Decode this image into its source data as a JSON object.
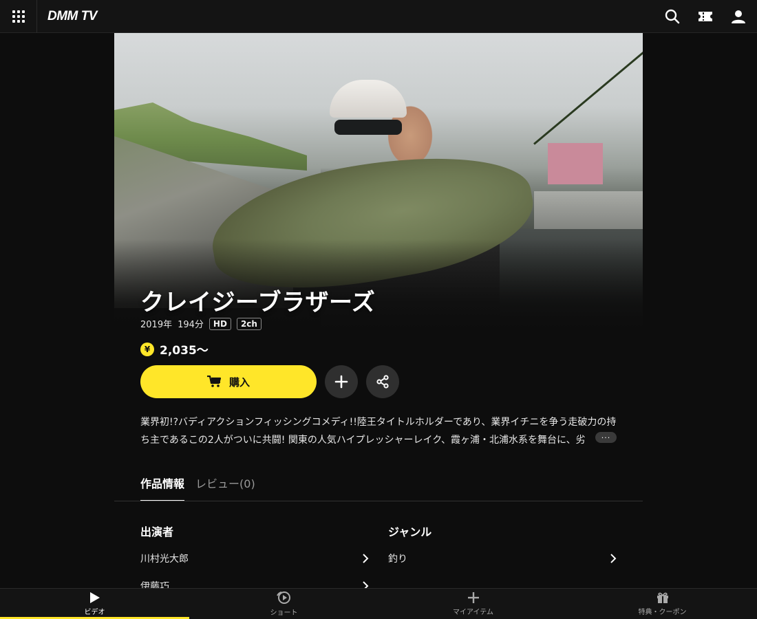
{
  "header": {
    "logo": "DMM TV",
    "icons": [
      "menu-grid-icon",
      "search-icon",
      "ticket-icon",
      "user-icon"
    ]
  },
  "title": {
    "name": "クレイジーブラザーズ",
    "year": "2019年",
    "duration": "194分",
    "badges": [
      "HD",
      "2ch"
    ],
    "price_symbol": "¥",
    "price": "2,035〜"
  },
  "actions": {
    "buy_label": "購入"
  },
  "description": {
    "text": "業界初!?バディアクションフィッシングコメディ!!陸王タイトルホルダーであり、業界イチニを争う走破力の持ち主であるこの2人がついに共闘! 関東の人気ハイプレッシャーレイク、霞ヶ浦・北浦水系を舞台に、劣",
    "more": "···"
  },
  "tabs": [
    {
      "label": "作品情報",
      "active": true
    },
    {
      "label": "レビュー(0)",
      "active": false
    }
  ],
  "info": {
    "cast_heading": "出演者",
    "cast": [
      "川村光大郎",
      "伊藤巧"
    ],
    "genre_heading": "ジャンル",
    "genres": [
      "釣り"
    ]
  },
  "bottom_nav": [
    {
      "label": "ビデオ",
      "icon": "play-icon",
      "active": true
    },
    {
      "label": "ショート",
      "icon": "shorts-icon",
      "active": false
    },
    {
      "label": "マイアイテム",
      "icon": "plus-icon",
      "active": false
    },
    {
      "label": "特典・クーポン",
      "icon": "gift-icon",
      "active": false
    }
  ],
  "colors": {
    "accent": "#ffe629",
    "background": "#0d0d0d"
  }
}
